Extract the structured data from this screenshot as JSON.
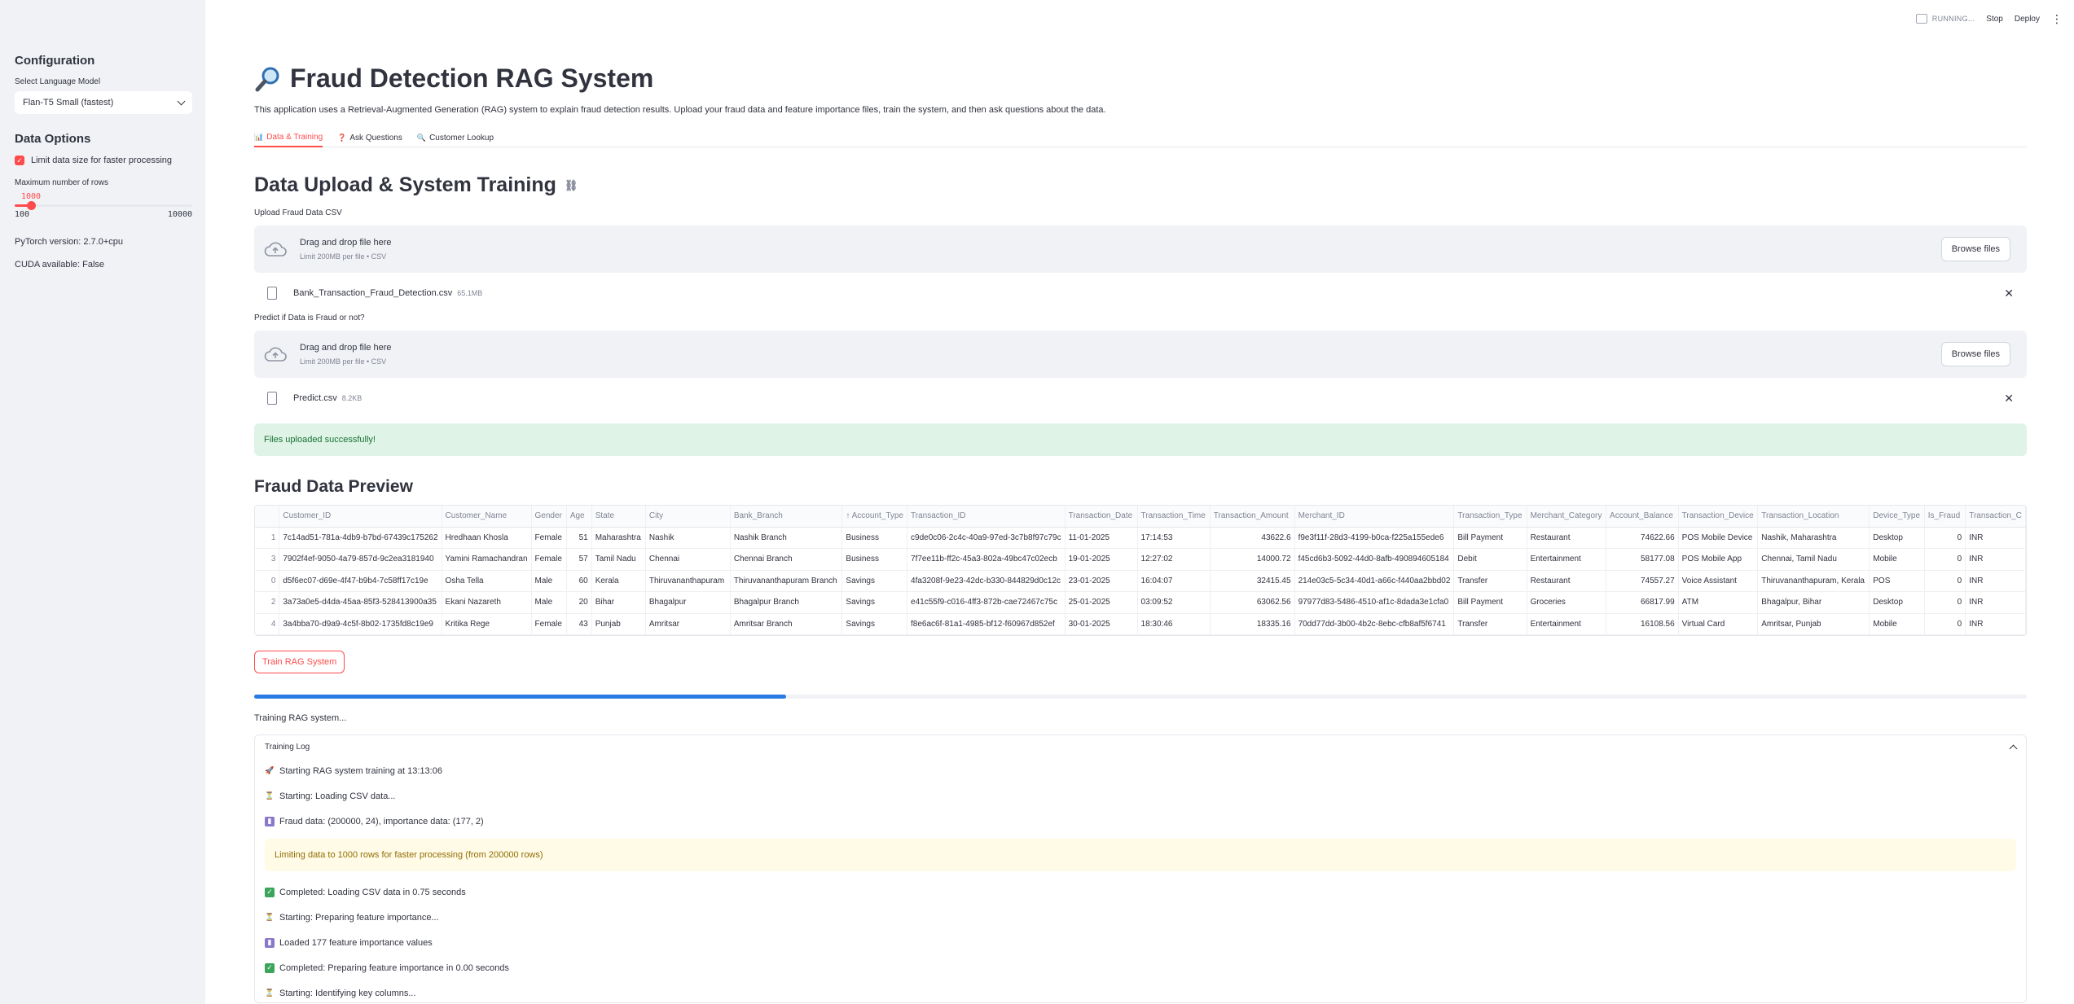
{
  "header": {
    "running_label": "RUNNING...",
    "stop_label": "Stop",
    "deploy_label": "Deploy",
    "menu_glyph": "⋮"
  },
  "sidebar": {
    "config_title": "Configuration",
    "model_label": "Select Language Model",
    "model_value": "Flan-T5 Small (fastest)",
    "data_options_title": "Data Options",
    "limit_checkbox_label": "Limit data size for faster processing",
    "limit_checked": true,
    "max_rows_label": "Maximum number of rows",
    "max_rows_value": "1000",
    "max_rows_min": "100",
    "max_rows_max": "10000",
    "slider_fraction": 0.0909,
    "pytorch_version": "PyTorch version: 2.7.0+cpu",
    "cuda_available": "CUDA available: False"
  },
  "main": {
    "title": "Fraud Detection RAG System",
    "title_icon": "magnifying-glass-icon",
    "description": "This application uses a Retrieval-Augmented Generation (RAG) system to explain fraud detection results. Upload your fraud data and feature importance files, train the system, and then ask questions about the data.",
    "tabs": [
      {
        "label": "Data & Training",
        "icon": "📊",
        "active": true
      },
      {
        "label": "Ask Questions",
        "icon": "❓",
        "active": false
      },
      {
        "label": "Customer Lookup",
        "icon": "🔍",
        "active": false
      }
    ],
    "section_title": "Data Upload & System Training",
    "upload1": {
      "label": "Upload Fraud Data CSV",
      "drag_text": "Drag and drop file here",
      "limit_text": "Limit 200MB per file • CSV",
      "browse_label": "Browse files",
      "file_name": "Bank_Transaction_Fraud_Detection.csv",
      "file_size": "65.1MB"
    },
    "upload2": {
      "label": "Predict if Data is Fraud or not?",
      "drag_text": "Drag and drop file here",
      "limit_text": "Limit 200MB per file • CSV",
      "browse_label": "Browse files",
      "file_name": "Predict.csv",
      "file_size": "8.2KB"
    },
    "success_message": "Files uploaded successfully!",
    "preview_title": "Fraud Data Preview",
    "train_button": "Train RAG System",
    "progress": 0.3,
    "status_text": "Training RAG system...",
    "log_title": "Training Log",
    "log_lines_a": [
      {
        "icon": "🚀",
        "cls": "e-rocket",
        "text": "Starting RAG system training at 13:13:06"
      },
      {
        "icon": "⏳",
        "cls": "e-hourglass",
        "text": "Starting: Loading CSV data..."
      },
      {
        "icon": "▮",
        "cls": "e-chart",
        "text": "Fraud data: (200000, 24), importance data: (177, 2)"
      }
    ],
    "log_warning": "Limiting data to 1000 rows for faster processing (from 200000 rows)",
    "log_lines_b": [
      {
        "icon": "✓",
        "cls": "e-check",
        "text": "Completed: Loading CSV data in 0.75 seconds"
      },
      {
        "icon": "⏳",
        "cls": "e-hourglass",
        "text": "Starting: Preparing feature importance..."
      },
      {
        "icon": "▮",
        "cls": "e-chart",
        "text": "Loaded 177 feature importance values"
      },
      {
        "icon": "✓",
        "cls": "e-check",
        "text": "Completed: Preparing feature importance in 0.00 seconds"
      },
      {
        "icon": "⏳",
        "cls": "e-hourglass",
        "text": "Starting: Identifying key columns..."
      }
    ]
  },
  "table": {
    "columns": [
      "",
      "Customer_ID",
      "Customer_Name",
      "Gender",
      "Age",
      "State",
      "City",
      "Bank_Branch",
      "Account_Type",
      "Transaction_ID",
      "Transaction_Date",
      "Transaction_Time",
      "Transaction_Amount",
      "Merchant_ID",
      "Transaction_Type",
      "Merchant_Category",
      "Account_Balance",
      "Transaction_Device",
      "Transaction_Location",
      "Device_Type",
      "Is_Fraud",
      "Transaction_C"
    ],
    "sorted_column": "Account_Type",
    "rows": [
      [
        "1",
        "7c14ad51-781a-4db9-b7bd-67439c175262",
        "Hredhaan Khosla",
        "Female",
        "51",
        "Maharashtra",
        "Nashik",
        "Nashik Branch",
        "Business",
        "c9de0c06-2c4c-40a9-97ed-3c7b8f97c79c",
        "11-01-2025",
        "17:14:53",
        "43622.6",
        "f9e3f11f-28d3-4199-b0ca-f225a155ede6",
        "Bill Payment",
        "Restaurant",
        "74622.66",
        "POS Mobile Device",
        "Nashik, Maharashtra",
        "Desktop",
        "0",
        "INR"
      ],
      [
        "3",
        "7902f4ef-9050-4a79-857d-9c2ea3181940",
        "Yamini Ramachandran",
        "Female",
        "57",
        "Tamil Nadu",
        "Chennai",
        "Chennai Branch",
        "Business",
        "7f7ee11b-ff2c-45a3-802a-49bc47c02ecb",
        "19-01-2025",
        "12:27:02",
        "14000.72",
        "f45cd6b3-5092-44d0-8afb-490894605184",
        "Debit",
        "Entertainment",
        "58177.08",
        "POS Mobile App",
        "Chennai, Tamil Nadu",
        "Mobile",
        "0",
        "INR"
      ],
      [
        "0",
        "d5f6ec07-d69e-4f47-b9b4-7c58ff17c19e",
        "Osha Tella",
        "Male",
        "60",
        "Kerala",
        "Thiruvananthapuram",
        "Thiruvananthapuram Branch",
        "Savings",
        "4fa3208f-9e23-42dc-b330-844829d0c12c",
        "23-01-2025",
        "16:04:07",
        "32415.45",
        "214e03c5-5c34-40d1-a66c-f440aa2bbd02",
        "Transfer",
        "Restaurant",
        "74557.27",
        "Voice Assistant",
        "Thiruvananthapuram, Kerala",
        "POS",
        "0",
        "INR"
      ],
      [
        "2",
        "3a73a0e5-d4da-45aa-85f3-528413900a35",
        "Ekani Nazareth",
        "Male",
        "20",
        "Bihar",
        "Bhagalpur",
        "Bhagalpur Branch",
        "Savings",
        "e41c55f9-c016-4ff3-872b-cae72467c75c",
        "25-01-2025",
        "03:09:52",
        "63062.56",
        "97977d83-5486-4510-af1c-8dada3e1cfa0",
        "Bill Payment",
        "Groceries",
        "66817.99",
        "ATM",
        "Bhagalpur, Bihar",
        "Desktop",
        "0",
        "INR"
      ],
      [
        "4",
        "3a4bba70-d9a9-4c5f-8b02-1735fd8c19e9",
        "Kritika Rege",
        "Female",
        "43",
        "Punjab",
        "Amritsar",
        "Amritsar Branch",
        "Savings",
        "f8e6ac6f-81a1-4985-bf12-f60967d852ef",
        "30-01-2025",
        "18:30:46",
        "18335.16",
        "70dd77dd-3b00-4b2c-8ebc-cfb8af5f6741",
        "Transfer",
        "Entertainment",
        "16108.56",
        "Virtual Card",
        "Amritsar, Punjab",
        "Mobile",
        "0",
        "INR"
      ]
    ]
  },
  "colors": {
    "accent": "#ff4b4b",
    "progress": "#2a7be4",
    "success_bg": "#dff3e6",
    "warning_bg": "#fffbe6"
  }
}
